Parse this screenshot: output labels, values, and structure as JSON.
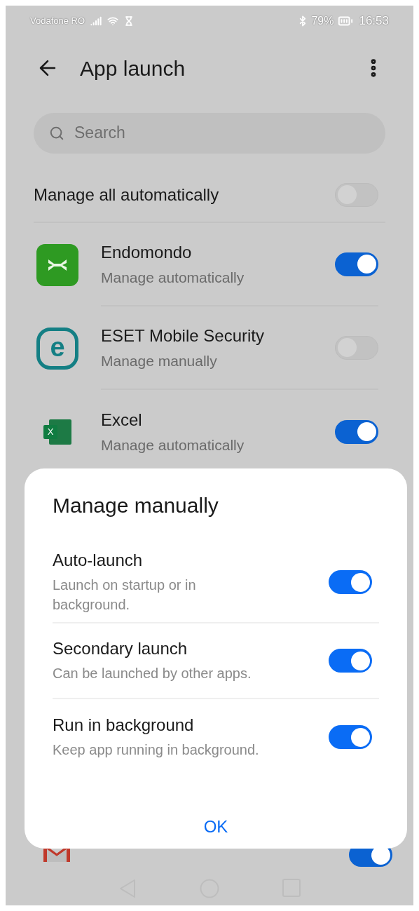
{
  "status_bar": {
    "carrier": "Vodafone RO",
    "battery": "79%",
    "time": "16:53"
  },
  "app_bar": {
    "title": "App launch"
  },
  "search": {
    "placeholder": "Search"
  },
  "manage_all": {
    "label": "Manage all automatically",
    "on": false
  },
  "apps": [
    {
      "name": "Endomondo",
      "mode": "Manage automatically",
      "on": true
    },
    {
      "name": "ESET Mobile Security",
      "mode": "Manage manually",
      "on": false,
      "logo_text": "e"
    },
    {
      "name": "Excel",
      "mode": "Manage automatically",
      "on": true,
      "logo_text": "X"
    }
  ],
  "partial_app": {
    "on": true
  },
  "dialog": {
    "title": "Manage manually",
    "options": [
      {
        "title": "Auto-launch",
        "description": "Launch on startup or in background.",
        "on": true
      },
      {
        "title": "Secondary launch",
        "description": "Can be launched by other apps.",
        "on": true
      },
      {
        "title": "Run in background",
        "description": "Keep app running in background.",
        "on": true
      }
    ],
    "button": "OK"
  }
}
